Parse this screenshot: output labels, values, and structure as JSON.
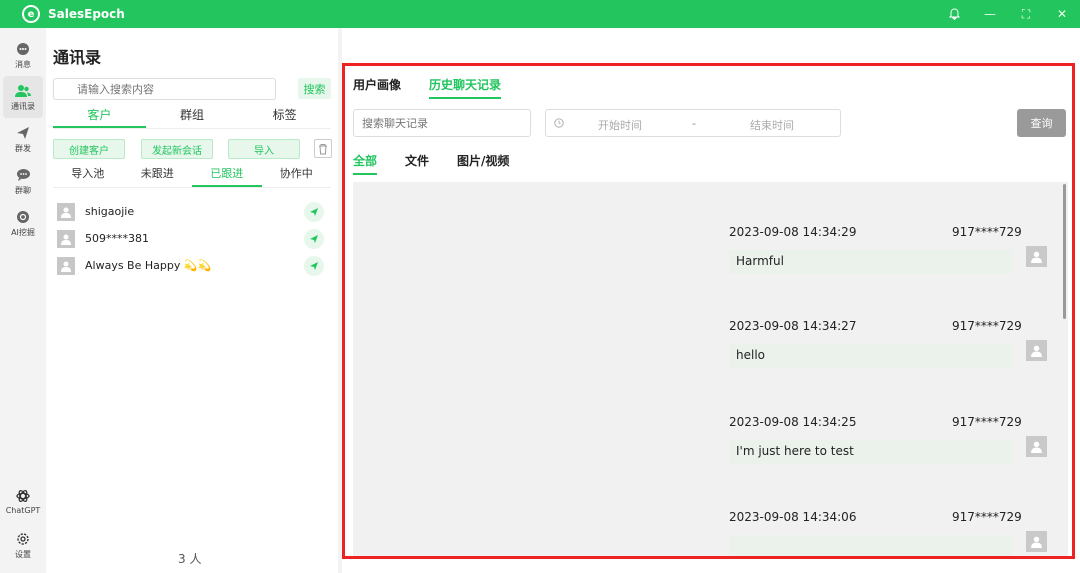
{
  "app": {
    "name": "SalesEpoch",
    "logo_letter": "e"
  },
  "window_controls": {
    "bell": "bell-icon",
    "minimize": "—",
    "maximize": "⛶",
    "close": "✕"
  },
  "sidebar": {
    "items": [
      {
        "label": "消息",
        "icon": "chat-bubble-icon"
      },
      {
        "label": "通讯录",
        "icon": "contacts-icon"
      },
      {
        "label": "群发",
        "icon": "send-icon"
      },
      {
        "label": "群聊",
        "icon": "group-chat-icon"
      },
      {
        "label": "AI挖掘",
        "icon": "ai-compass-icon"
      }
    ],
    "bottom": [
      {
        "label": "ChatGPT",
        "icon": "chatgpt-icon"
      },
      {
        "label": "设置",
        "icon": "gear-icon"
      }
    ]
  },
  "contacts": {
    "title": "通讯录",
    "search_placeholder": "请输入搜索内容",
    "search_label": "搜索",
    "tabs": [
      "客户",
      "群组",
      "标签"
    ],
    "actions": [
      "创建客户",
      "发起新会话",
      "导入"
    ],
    "subtabs": [
      "导入池",
      "未跟进",
      "已跟进",
      "协作中"
    ],
    "list": [
      {
        "name": "shigaojie"
      },
      {
        "name": "509****381"
      },
      {
        "name": "Always Be Happy 💫💫"
      }
    ],
    "count_text": "3  人"
  },
  "panel": {
    "tabs": [
      "用户画像",
      "历史聊天记录"
    ],
    "search_placeholder": "搜索聊天记录",
    "date_start": "开始时间",
    "date_sep": "-",
    "date_end": "结束时间",
    "query_label": "查询",
    "filter_tabs": [
      "全部",
      "文件",
      "图片/视频"
    ],
    "messages": [
      {
        "time": "2023-09-08 14:34:29",
        "sender": "917****729",
        "text": "Harmful"
      },
      {
        "time": "2023-09-08 14:34:27",
        "sender": "917****729",
        "text": "hello"
      },
      {
        "time": "2023-09-08 14:34:25",
        "sender": "917****729",
        "text": "I'm just here to test"
      },
      {
        "time": "2023-09-08 14:34:06",
        "sender": "917****729",
        "text": ""
      }
    ]
  },
  "colors": {
    "accent": "#22c55e",
    "highlight_border": "#ee2222",
    "button_gray": "#9a9a9a"
  }
}
